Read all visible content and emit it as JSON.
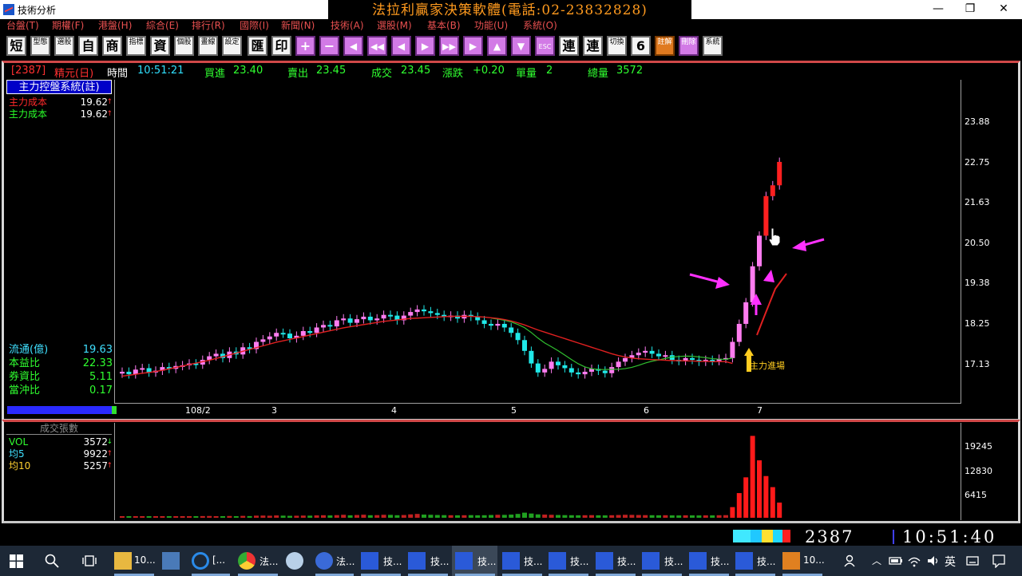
{
  "window": {
    "title": "技術分析",
    "banner": "法拉利贏家決策軟體(電話:02-23832828)",
    "minimize": "—",
    "maximize": "❐",
    "close": "✕"
  },
  "menu": [
    "台盤(T)",
    "期權(F)",
    "港盤(H)",
    "綜合(E)",
    "排行(R)",
    "國際(I)",
    "新聞(N)",
    "技術(A)",
    "選股(M)",
    "基本(B)",
    "功能(U)",
    "系統(O)"
  ],
  "toolbar": {
    "buttons": [
      "短",
      "型態",
      "選股",
      "自",
      "商",
      "指標",
      "資",
      "個股",
      "畫線",
      "設定",
      "匯",
      "印",
      "+",
      "−",
      "◀",
      "◀◀",
      "◀",
      "▶",
      "▶▶",
      "▶",
      "▲",
      "▼",
      "ESC",
      "連",
      "連",
      "切換",
      "6",
      "註解",
      "刪除",
      "系統"
    ]
  },
  "status": {
    "code": "[2387]",
    "name": "精元(日)",
    "time_label": "時間",
    "time": "10:51:21",
    "bid_label": "買進",
    "bid": "23.40",
    "ask_label": "賣出",
    "ask": "23.45",
    "deal_label": "成交",
    "deal": "23.45",
    "change_label": "漲跌",
    "change": "+0.20",
    "lot_label": "單量",
    "lot": "2",
    "total_label": "總量",
    "total": "3572"
  },
  "left_panel": {
    "title": "主力控盤系統(註)",
    "rows": [
      {
        "label": "主力成本",
        "value": "19.62",
        "arrow": "↑",
        "label_color": "#ff2a2a"
      },
      {
        "label": "主力成本",
        "value": "19.62",
        "arrow": "↑",
        "label_color": "#2aff2a"
      }
    ],
    "stats": [
      {
        "label": "流通(億)",
        "value": "19.63",
        "color": "#40e0ff",
        "vcolor": "#40e0ff"
      },
      {
        "label": "本益比",
        "value": "22.33",
        "color": "#30ff30",
        "vcolor": "#30ff30"
      },
      {
        "label": "券資比",
        "value": "5.11",
        "color": "#30ff30",
        "vcolor": "#30ff30"
      },
      {
        "label": "當沖比",
        "value": "0.17",
        "color": "#30ff30",
        "vcolor": "#30ff30"
      }
    ]
  },
  "volume_panel": {
    "title": "成交張數",
    "rows": [
      {
        "label": "VOL",
        "value": "3572",
        "arrow": "↓",
        "color": "#30ff30"
      },
      {
        "label": "均5",
        "value": "9922",
        "arrow": "↑",
        "color": "#40e0ff"
      },
      {
        "label": "均10",
        "value": "5257",
        "arrow": "↑",
        "color": "#ffd030"
      }
    ]
  },
  "chart_data": {
    "type": "candlestick",
    "price_axis": [
      "23.88",
      "22.75",
      "21.63",
      "20.50",
      "19.38",
      "18.25",
      "17.13"
    ],
    "ylim": [
      16.6,
      24.4
    ],
    "month_labels": [
      "108/2",
      "3",
      "4",
      "5",
      "6",
      "7"
    ],
    "volume_axis": [
      "19245",
      "12830",
      "6415"
    ],
    "annotation": "主力進場",
    "series": [
      {
        "name": "close",
        "values": [
          17.62,
          17.55,
          17.68,
          17.72,
          17.6,
          17.65,
          17.75,
          17.7,
          17.78,
          17.8,
          17.85,
          17.82,
          17.95,
          18.05,
          18.12,
          18.0,
          18.18,
          18.1,
          18.3,
          18.25,
          18.45,
          18.52,
          18.6,
          18.7,
          18.68,
          18.55,
          18.62,
          18.75,
          18.7,
          18.85,
          18.92,
          18.88,
          19.05,
          19.1,
          18.98,
          19.08,
          19.15,
          19.05,
          19.1,
          19.2,
          19.18,
          19.05,
          19.18,
          19.28,
          19.35,
          19.3,
          19.25,
          19.2,
          19.15,
          19.18,
          19.1,
          19.2,
          19.15,
          19.05,
          18.95,
          18.9,
          18.95,
          18.85,
          18.7,
          18.5,
          18.2,
          17.85,
          17.6,
          17.7,
          17.9,
          17.8,
          17.72,
          17.6,
          17.55,
          17.62,
          17.7,
          17.65,
          17.58,
          17.75,
          17.9,
          18.0,
          18.08,
          18.15,
          18.2,
          18.12,
          18.05,
          18.08,
          17.95,
          17.92,
          18.0,
          17.95,
          17.9,
          17.95,
          17.92,
          17.98,
          18.0,
          18.45,
          18.95,
          19.55,
          20.55,
          21.4,
          22.5,
          22.8,
          23.45
        ]
      },
      {
        "name": "主力成本",
        "values": [
          17.5,
          17.52,
          17.55,
          17.58,
          17.6,
          17.63,
          17.66,
          17.7,
          17.74,
          17.78,
          17.82,
          17.86,
          17.9,
          17.94,
          17.99,
          18.04,
          18.09,
          18.14,
          18.19,
          18.24,
          18.29,
          18.34,
          18.39,
          18.44,
          18.48,
          18.52,
          18.56,
          18.6,
          18.64,
          18.68,
          18.72,
          18.76,
          18.8,
          18.84,
          18.87,
          18.9,
          18.93,
          18.96,
          18.99,
          19.02,
          19.04,
          19.06,
          19.08,
          19.1,
          19.11,
          19.12,
          19.13,
          19.14,
          19.15,
          19.16,
          19.16,
          19.16,
          19.16,
          19.15,
          19.14,
          19.12,
          19.1,
          19.07,
          19.03,
          18.98,
          18.92,
          18.85,
          18.78,
          18.72,
          18.66,
          18.6,
          18.54,
          18.48,
          18.42,
          18.36,
          18.3,
          18.24,
          18.18,
          18.12,
          18.07,
          18.03,
          18.0,
          17.98,
          17.97,
          17.96,
          17.95,
          17.94,
          17.93,
          17.93,
          17.92,
          17.92,
          17.91,
          17.91,
          17.9,
          17.9,
          17.9,
          17.85,
          18.1,
          18.6,
          19.2,
          19.6
        ]
      },
      {
        "name": "volume",
        "values": [
          300,
          250,
          280,
          320,
          260,
          300,
          350,
          280,
          300,
          330,
          360,
          310,
          400,
          420,
          380,
          350,
          420,
          380,
          450,
          400,
          500,
          520,
          480,
          550,
          500,
          460,
          480,
          520,
          500,
          560,
          600,
          550,
          620,
          700,
          580,
          650,
          720,
          600,
          620,
          700,
          680,
          600,
          650,
          800,
          900,
          750,
          700,
          650,
          620,
          600,
          580,
          600,
          620,
          580,
          600,
          650,
          700,
          680,
          750,
          900,
          1200,
          1000,
          800,
          750,
          700,
          650,
          620,
          600,
          580,
          600,
          620,
          580,
          560,
          600,
          650,
          700,
          680,
          650,
          620,
          600,
          580,
          600,
          560,
          550,
          580,
          560,
          550,
          570,
          560,
          600,
          620,
          2500,
          5800,
          9500,
          19245,
          13500,
          9800,
          7200,
          3572
        ]
      }
    ]
  },
  "quote_bar": {
    "code": "2387",
    "time": "10:51:40"
  },
  "taskbar": {
    "items": [
      "10...",
      "[...",
      "法...",
      "法...",
      "技...",
      "技...",
      "技...",
      "技...",
      "技...",
      "技...",
      "技...",
      "技...",
      "技...",
      "10..."
    ],
    "ime": "英"
  }
}
